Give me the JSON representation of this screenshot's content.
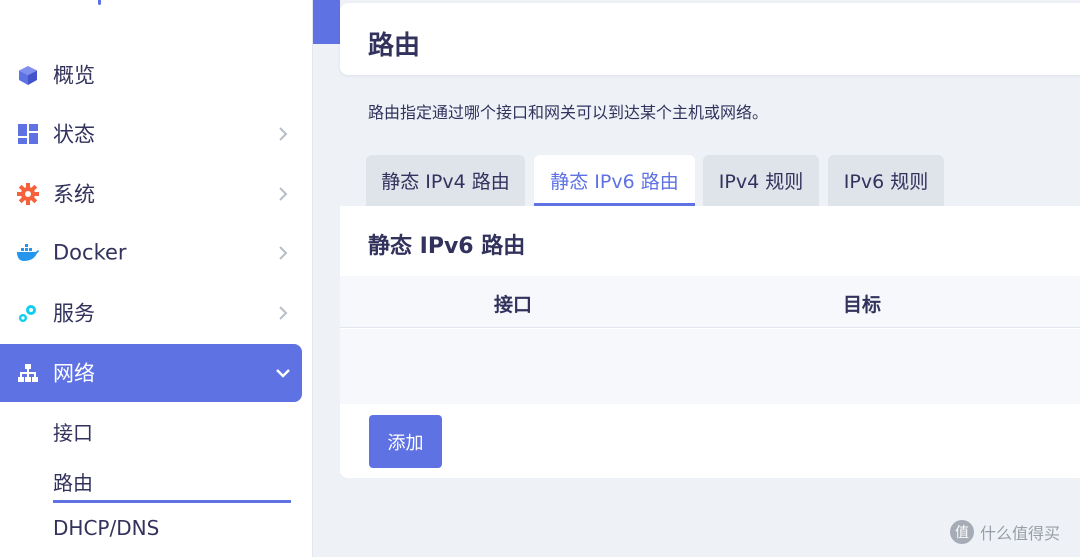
{
  "sidebar": {
    "items": [
      {
        "label": "概览",
        "icon": "cube-icon"
      },
      {
        "label": "状态",
        "icon": "dashboard-icon"
      },
      {
        "label": "系统",
        "icon": "gear-icon"
      },
      {
        "label": "Docker",
        "icon": "docker-icon"
      },
      {
        "label": "服务",
        "icon": "services-icon"
      },
      {
        "label": "网络",
        "icon": "network-icon",
        "active": true
      }
    ],
    "sub_items": [
      {
        "label": "接口"
      },
      {
        "label": "路由",
        "active": true
      },
      {
        "label": "DHCP/DNS"
      }
    ]
  },
  "page": {
    "title": "路由",
    "description": "路由指定通过哪个接口和网关可以到达某个主机或网络。"
  },
  "tabs": [
    {
      "label": "静态 IPv4 路由"
    },
    {
      "label": "静态 IPv6 路由",
      "active": true
    },
    {
      "label": "IPv4 规则"
    },
    {
      "label": "IPv6 规则"
    }
  ],
  "panel": {
    "title": "静态 IPv6 路由",
    "columns": [
      "接口",
      "目标"
    ],
    "add_label": "添加"
  },
  "watermark": {
    "badge": "值",
    "text": "什么值得买"
  },
  "colors": {
    "accent": "#5e72e4",
    "background": "#eef1f6",
    "text": "#32325d"
  }
}
